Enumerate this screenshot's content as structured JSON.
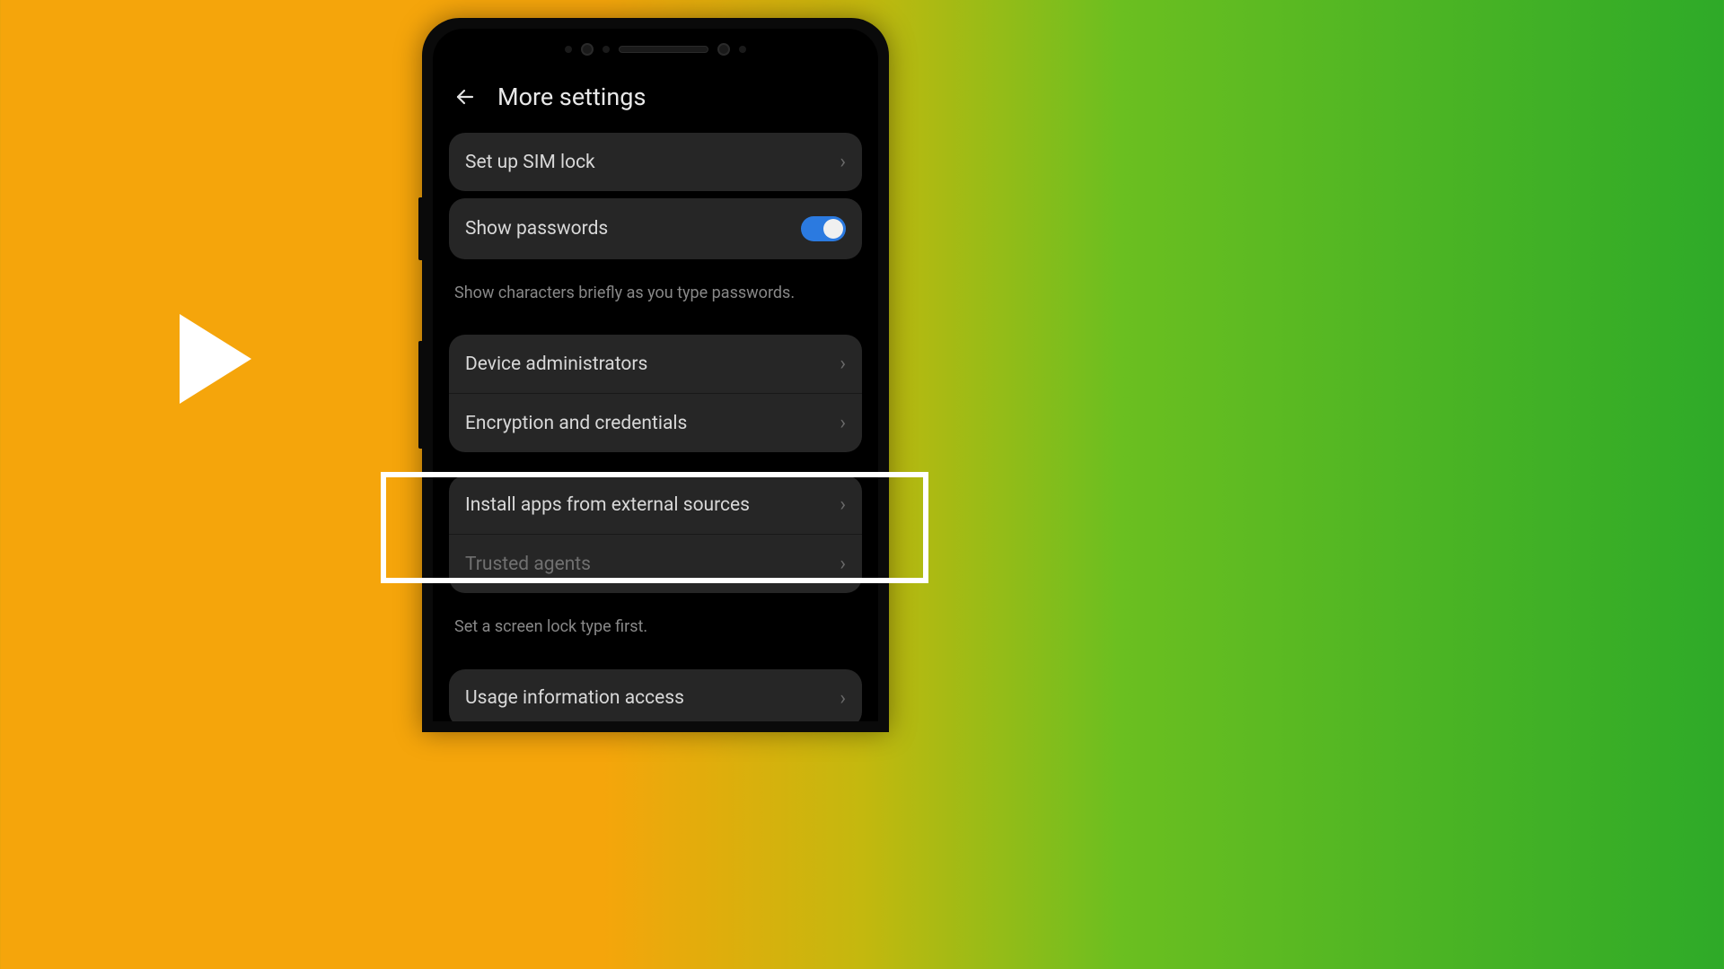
{
  "header": {
    "title": "More settings"
  },
  "rows": {
    "sim_lock": "Set up SIM lock",
    "show_passwords": "Show passwords",
    "show_passwords_hint": "Show characters briefly as you type passwords.",
    "device_admin": "Device administrators",
    "encryption": "Encryption and credentials",
    "install_external": "Install apps from external sources",
    "trusted_agents": "Trusted agents",
    "trusted_hint": "Set a screen lock type first.",
    "usage_info": "Usage information access"
  },
  "toggles": {
    "show_passwords": true
  }
}
